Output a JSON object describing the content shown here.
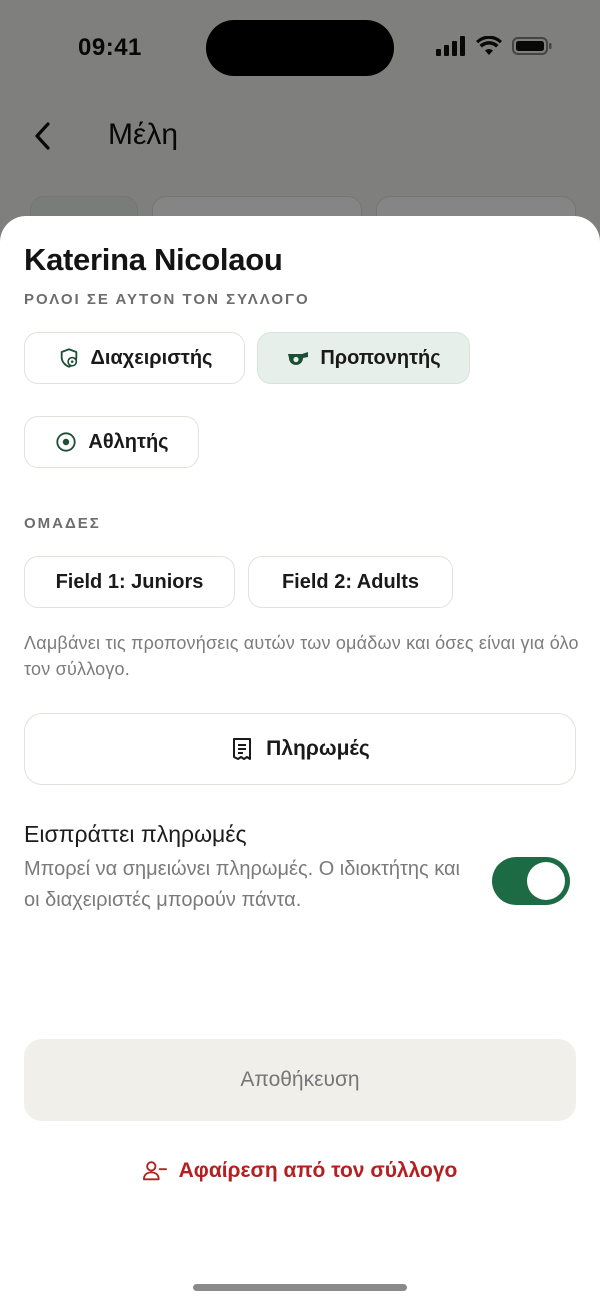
{
  "status_bar": {
    "time": "09:41"
  },
  "background_screen": {
    "title": "Μέλη"
  },
  "sheet": {
    "member_name": "Katerina Nicolaou",
    "roles_label": "ΡΟΛΟΙ ΣΕ ΑΥΤΟΝ ΤΟΝ ΣΥΛΛΟΓΟ",
    "roles": [
      {
        "label": "Διαχειριστής",
        "icon": "shield-icon",
        "selected": false
      },
      {
        "label": "Προπονητής",
        "icon": "whistle-icon",
        "selected": true
      },
      {
        "label": "Αθλητής",
        "icon": "target-icon",
        "selected": false
      }
    ],
    "teams_label": "ΟΜΑΔΕΣ",
    "teams": [
      {
        "label": "Field 1: Juniors"
      },
      {
        "label": "Field 2: Adults"
      }
    ],
    "teams_hint": "Λαμβάνει τις προπονήσεις αυτών των ομάδων και όσες είναι για όλο τον σύλλογο.",
    "payments_button": {
      "label": "Πληρωμές",
      "icon": "receipt-icon"
    },
    "collects_payments": {
      "title": "Εισπράττει πληρωμές",
      "description": "Μπορεί να σημειώνει πληρωμές. Ο ιδιοκτήτης και οι διαχειριστές μπορούν πάντα.",
      "enabled": true
    },
    "save_button": {
      "label": "Αποθήκευση"
    },
    "remove_button": {
      "label": "Αφαίρεση από τον σύλλογο",
      "icon": "user-minus-icon"
    }
  },
  "colors": {
    "accent": "#1d6b45",
    "selected_chip_bg": "#e6efe9",
    "danger": "#b42020",
    "save_bg": "#f0efea"
  }
}
